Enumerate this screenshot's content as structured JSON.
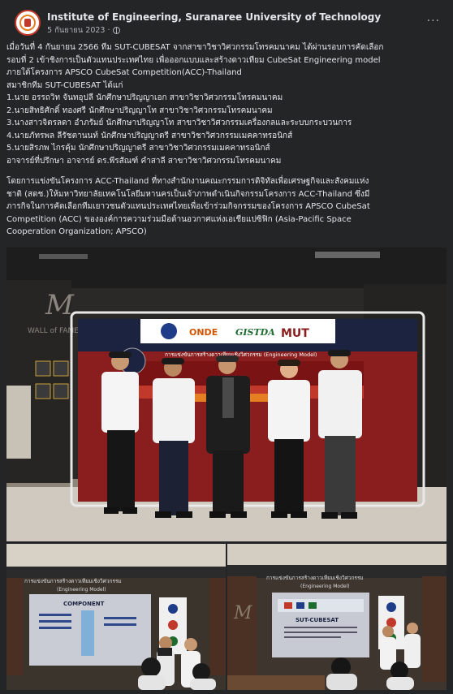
{
  "post": {
    "page_name": "Institute of Engineering, Suranaree University of Technology",
    "date": "5 กันยายน 2023",
    "separator": "·",
    "more_label": "···"
  },
  "body": {
    "lines": [
      "เมื่อวันที่ 4 กันยายน 2566 ทีม SUT-CUBESAT จากสาขาวิชาวิศวกรรมโทรคมนาคม ได้ผ่านรอบการคัดเลือก",
      "รอบที่ 2 เข้าชิงการเป็นตัวแทนประเทศไทย เพื่อออกแบบและสร้างดาวเทียม CubeSat Engineering model",
      "ภายใต้โครงการ APSCO CubeSat Competition(ACC)-Thailand",
      "สมาชิกทีม SUT-CUBESAT ได้แก่",
      "1.นาย อรรถวิท จันทอุปลี นักศึกษาปริญญาเอก สาขาวิชาวิศวกรรมโทรคมนาคม",
      "2.นายสิทธิศักดิ์ ทองศรี นักศึกษาปริญญาโท สาขาวิชาวิศวกรรมโทรคมนาคม",
      "3.นางสาวจิตรลดา อำภรัมย์ นักศึกษาปริญญาโท สาขาวิชาวิศวกรรมเครื่องกลและระบบกระบวนการ",
      "4.นายภัทรพล ลีรัชตานนท์ นักศึกษาปริญญาตรี สาขาวิชาวิศวกรรมเมคคาทรอนิกส์",
      "5.นายสิรภพ ไกรคุ้ม นักศึกษาปริญญาตรี สาขาวิชาวิศวกรรมเมคคาทรอนิกส์",
      "อาจารย์ที่ปรึกษา อาจารย์ ดร.พีรสัณฑ์ คำสาลี สาขาวิชาวิศวกรรมโทรคมนาคม"
    ],
    "para2": [
      "โดยการแข่งขันโครงการ ACC-Thailand ที่ทางสำนักงานคณะกรรมการดิจิทัลเพื่อเศรษฐกิจและสังคมแห่ง",
      "ชาติ (สดช.)ให้มหาวิทยาลัยเทคโนโลยีมหานครเป็นเจ้าภาพดำเนินกิจกรรมโครงการ ACC-Thailand ซึ่งมี",
      "ภารกิจในการคัดเลือกทีมเยาวชนตัวแทนประเทศไทยเพื่อเข้าร่วมกิจกรรมของโครงการ APSCO CubeSat",
      "Competition (ACC) ขององค์การความร่วมมือด้านอวกาศแห่งเอเชียแปซิฟิก (Asia-Pacific Space",
      "Cooperation Organization; APSCO)"
    ]
  },
  "photos": {
    "main": {
      "banner_logos": [
        "ONDE",
        "GISTDA",
        "MUT"
      ],
      "banner_heading": "การแข่งขันการสร้างดาวเทียมเชิงวิศวกรรม (Engineering Model)",
      "wall_text": "WALL of FAME",
      "wall_logo": "M"
    },
    "bottom_left": {
      "banner": "การแข่งขันการสร้างดาวเทียมเชิงวิศวกรรม",
      "banner_sub": "(Engineering Model)",
      "slide_title": "COMPONENT"
    },
    "bottom_right": {
      "banner": "การแข่งขันการสร้างดาวเทียมเชิงวิศวกรรม",
      "banner_sub": "(Engineering Model)",
      "slide_title": "SUT-CUBESAT",
      "wall_logo": "M"
    }
  }
}
